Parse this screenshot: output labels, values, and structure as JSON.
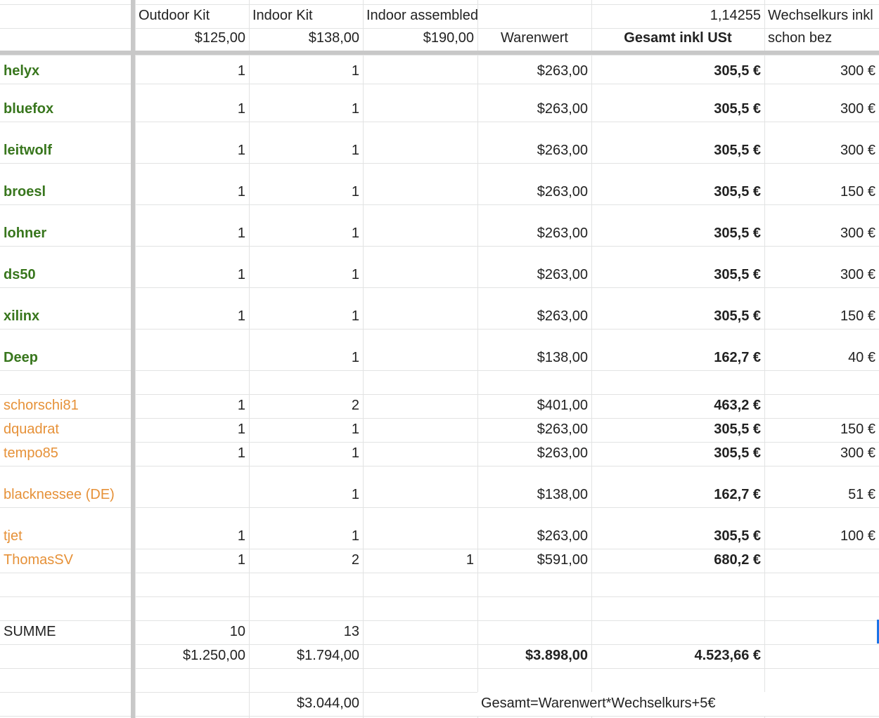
{
  "header": {
    "row1": [
      "",
      "Outdoor Kit",
      "Indoor Kit",
      "Indoor assembled",
      "",
      "1,14255",
      "Wechselkurs inkl"
    ],
    "row2": [
      "",
      "$125,00",
      "$138,00",
      "$190,00",
      "Warenwert",
      "Gesamt inkl USt",
      "schon bez"
    ]
  },
  "rows": [
    {
      "name": "helyx",
      "outdoor": "1",
      "indoor": "1",
      "assembled": "",
      "warenwert": "$263,00",
      "gesamt": "305,5 €",
      "bezahlt": "300 €",
      "group": "green"
    },
    {
      "name": "bluefox",
      "outdoor": "1",
      "indoor": "1",
      "assembled": "",
      "warenwert": "$263,00",
      "gesamt": "305,5 €",
      "bezahlt": "300 €",
      "group": "green"
    },
    {
      "name": "leitwolf",
      "outdoor": "1",
      "indoor": "1",
      "assembled": "",
      "warenwert": "$263,00",
      "gesamt": "305,5 €",
      "bezahlt": "300 €",
      "group": "green"
    },
    {
      "name": "broesl",
      "outdoor": "1",
      "indoor": "1",
      "assembled": "",
      "warenwert": "$263,00",
      "gesamt": "305,5 €",
      "bezahlt": "150 €",
      "group": "green"
    },
    {
      "name": "lohner",
      "outdoor": "1",
      "indoor": "1",
      "assembled": "",
      "warenwert": "$263,00",
      "gesamt": "305,5 €",
      "bezahlt": "300 €",
      "group": "green"
    },
    {
      "name": "ds50",
      "outdoor": "1",
      "indoor": "1",
      "assembled": "",
      "warenwert": "$263,00",
      "gesamt": "305,5 €",
      "bezahlt": "300 €",
      "group": "green"
    },
    {
      "name": "xilinx",
      "outdoor": "1",
      "indoor": "1",
      "assembled": "",
      "warenwert": "$263,00",
      "gesamt": "305,5 €",
      "bezahlt": "150 €",
      "group": "green"
    },
    {
      "name": "Deep",
      "outdoor": "",
      "indoor": "1",
      "assembled": "",
      "warenwert": "$138,00",
      "gesamt": "162,7 €",
      "bezahlt": "40 €",
      "group": "green"
    },
    {
      "name": "",
      "outdoor": "",
      "indoor": "",
      "assembled": "",
      "warenwert": "",
      "gesamt": "",
      "bezahlt": "",
      "group": ""
    },
    {
      "name": "schorschi81",
      "outdoor": "1",
      "indoor": "2",
      "assembled": "",
      "warenwert": "$401,00",
      "gesamt": "463,2 €",
      "bezahlt": "",
      "group": "orange"
    },
    {
      "name": "dquadrat",
      "outdoor": "1",
      "indoor": "1",
      "assembled": "",
      "warenwert": "$263,00",
      "gesamt": "305,5 €",
      "bezahlt": "150 €",
      "group": "orange"
    },
    {
      "name": "tempo85",
      "outdoor": "1",
      "indoor": "1",
      "assembled": "",
      "warenwert": "$263,00",
      "gesamt": "305,5 €",
      "bezahlt": "300 €",
      "group": "orange"
    },
    {
      "name": "blacknessee (DE)",
      "outdoor": "",
      "indoor": "1",
      "assembled": "",
      "warenwert": "$138,00",
      "gesamt": "162,7 €",
      "bezahlt": "51 €",
      "group": "orange"
    },
    {
      "name": "tjet",
      "outdoor": "1",
      "indoor": "1",
      "assembled": "",
      "warenwert": "$263,00",
      "gesamt": "305,5 €",
      "bezahlt": "100 €",
      "group": "orange"
    },
    {
      "name": "ThomasSV",
      "outdoor": "1",
      "indoor": "2",
      "assembled": "1",
      "warenwert": "$591,00",
      "gesamt": "680,2 €",
      "bezahlt": "",
      "group": "orange"
    },
    {
      "name": "",
      "outdoor": "",
      "indoor": "",
      "assembled": "",
      "warenwert": "",
      "gesamt": "",
      "bezahlt": "",
      "group": ""
    },
    {
      "name": "",
      "outdoor": "",
      "indoor": "",
      "assembled": "",
      "warenwert": "",
      "gesamt": "",
      "bezahlt": "",
      "group": ""
    },
    {
      "name": "SUMME",
      "outdoor": "10",
      "indoor": "13",
      "assembled": "",
      "warenwert": "",
      "gesamt": "",
      "bezahlt": "",
      "group": "plain"
    },
    {
      "name": "",
      "outdoor": "$1.250,00",
      "indoor": "$1.794,00",
      "assembled": "",
      "warenwert": "$3.898,00",
      "gesamt": "4.523,66 €",
      "bezahlt": "",
      "group": "totals"
    },
    {
      "name": "",
      "outdoor": "",
      "indoor": "",
      "assembled": "",
      "warenwert": "",
      "gesamt": "",
      "bezahlt": "",
      "group": ""
    },
    {
      "name": "",
      "outdoor": "",
      "indoor": "$3.044,00",
      "assembled": "",
      "warenwert": "",
      "gesamt": "",
      "bezahlt": "",
      "group": "plain"
    }
  ],
  "formula_note": "Gesamt=Warenwert*Wechselkurs+5€"
}
